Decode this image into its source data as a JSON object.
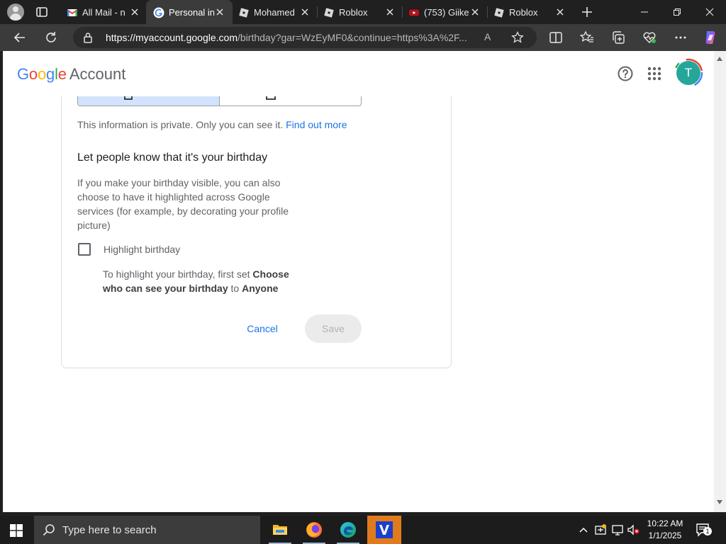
{
  "browser": {
    "tabs": [
      {
        "title": "All Mail - n",
        "icon": "gmail-icon"
      },
      {
        "title": "Personal in",
        "icon": "google-g-icon"
      },
      {
        "title": "Mohamed",
        "icon": "roblox-icon"
      },
      {
        "title": "Roblox",
        "icon": "roblox-icon"
      },
      {
        "title": "(753) Giike",
        "icon": "youtube-icon"
      },
      {
        "title": "Roblox",
        "icon": "roblox-icon"
      }
    ],
    "url_host": "https://myaccount.google.com",
    "url_path": "/birthday?gar=WzEyMF0&continue=https%3A%2F...",
    "read_aloud": "A"
  },
  "google_header": {
    "brand": "Google",
    "product": "Account",
    "avatar_initial": "T"
  },
  "birthday": {
    "private_text": "This information is private. Only you can see it.",
    "find_out_more": "Find out more",
    "section_title": "Let people know that it's your birthday",
    "description": "If you make your birthday visible, you can also choose to have it highlighted across Google services (for example, by decorating your profile picture)",
    "checkbox_label": "Highlight birthday",
    "checkbox_checked": false,
    "hint_prefix": "To highlight your birthday, first set",
    "hint_setting": "Choose who can see your birthday",
    "hint_to": "to",
    "hint_value": "Anyone",
    "cancel_label": "Cancel",
    "save_label": "Save"
  },
  "taskbar": {
    "search_placeholder": "Type here to search",
    "time": "10:22 AM",
    "date": "1/1/2025",
    "notification_count": "1"
  },
  "colors": {
    "accent_blue": "#1a73e8",
    "avatar": "#26a69a",
    "segment_selected": "#d3e3fd"
  }
}
